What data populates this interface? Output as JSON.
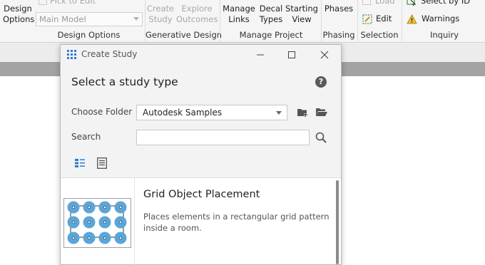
{
  "ribbon": {
    "design_options": {
      "label_line1": "Design",
      "label_line2": "Options",
      "pick_to_edit": "Pick to Edit",
      "main_model": "Main Model",
      "panel_title": "Design Options"
    },
    "generative_design": {
      "create_study_line1": "Create",
      "create_study_line2": "Study",
      "explore_line1": "Explore",
      "explore_line2": "Outcomes",
      "panel_title": "Generative Design"
    },
    "manage_project": {
      "manage_links_line1": "Manage",
      "manage_links_line2": "Links",
      "decal_types_line1": "Decal",
      "decal_types_line2": "Types",
      "starting_view_line1": "Starting",
      "starting_view_line2": "View",
      "panel_title": "Manage Project"
    },
    "phasing": {
      "phases": "Phases",
      "panel_title": "Phasing"
    },
    "selection": {
      "load": "Load",
      "edit": "Edit",
      "panel_title": "Selection"
    },
    "inquiry": {
      "select_by_id": "Select  by ID",
      "warnings": "Warnings",
      "panel_title": "Inquiry"
    }
  },
  "dialog": {
    "title": "Create Study",
    "heading": "Select a study type",
    "choose_folder_label": "Choose Folder",
    "folder_value": "Autodesk Samples",
    "search_label": "Search",
    "search_placeholder": "",
    "study": {
      "title": "Grid Object Placement",
      "description": "Places elements in a rectangular grid pattern inside a room."
    }
  },
  "icons": {
    "app": "grid-app-icon",
    "help": "help-icon",
    "new_folder": "new-folder-icon",
    "open_folder": "open-folder-icon",
    "search": "search-icon",
    "tile_view": "tile-view-icon",
    "list_view": "list-view-icon"
  },
  "colors": {
    "accent": "#2d7dd2",
    "grid_circle": "#5aa6d8",
    "disabled_text": "#a8a8a8"
  }
}
